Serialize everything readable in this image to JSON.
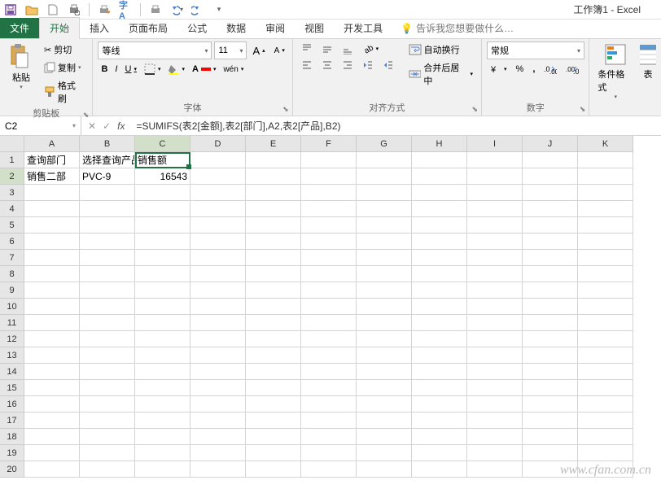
{
  "title": "工作簿1 - Excel",
  "tabs": {
    "file": "文件",
    "home": "开始",
    "insert": "插入",
    "pageLayout": "页面布局",
    "formulas": "公式",
    "data": "数据",
    "review": "审阅",
    "view": "视图",
    "developer": "开发工具",
    "tellMe": "告诉我您想要做什么…"
  },
  "ribbon": {
    "clipboard": {
      "label": "剪贴板",
      "paste": "粘贴",
      "cut": "剪切",
      "copy": "复制",
      "formatPainter": "格式刷"
    },
    "font": {
      "label": "字体",
      "fontName": "等线",
      "fontSize": "11",
      "pinyin": "wén"
    },
    "alignment": {
      "label": "对齐方式",
      "wrap": "自动换行",
      "merge": "合并后居中"
    },
    "number": {
      "label": "数字",
      "format": "常规"
    },
    "styles": {
      "condFmt": "条件格式",
      "tableFmt": "表"
    }
  },
  "nameBox": "C2",
  "formula": "=SUMIFS(表2[金额],表2[部门],A2,表2[产品],B2)",
  "columns": [
    "A",
    "B",
    "C",
    "D",
    "E",
    "F",
    "G",
    "H",
    "I",
    "J",
    "K"
  ],
  "rows": [
    "1",
    "2",
    "3",
    "4",
    "5",
    "6",
    "7",
    "8",
    "9",
    "10",
    "11",
    "12",
    "13",
    "14",
    "15",
    "16",
    "17",
    "18",
    "19",
    "20"
  ],
  "sheet": {
    "A1": "查询部门",
    "B1": "选择查询产品",
    "C1": "销售额",
    "A2": "销售二部",
    "B2": "PVC-9",
    "C2": "16543"
  },
  "selectedCol": "C",
  "selectedRow": "2",
  "watermark": "www.cfan.com.cn"
}
